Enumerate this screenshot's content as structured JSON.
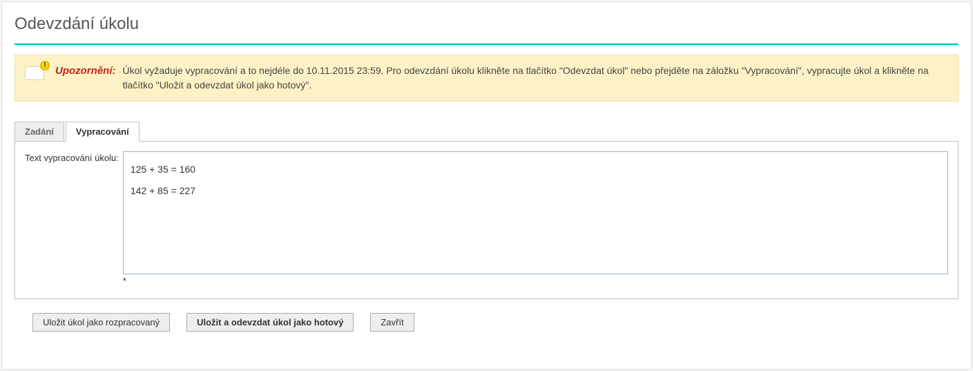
{
  "page": {
    "title": "Odevzdání úkolu"
  },
  "alert": {
    "label": "Upozornění:",
    "text": "Úkol vyžaduje vypracování a to nejdéle do 10.11.2015 23:59. Pro odevzdání úkolu klikněte na tlačítko \"Odevzdat úkol\" nebo přejděte na záložku \"Vypracování\", vypracujte úkol a klikněte na tlačítko \"Uložit a odevzdat úkol jako hotový\"."
  },
  "tabs": {
    "assignment": "Zadání",
    "elaboration": "Vypracování"
  },
  "form": {
    "label": "Text vypracování úkolu:",
    "value": "125 + 35 = 160\n142 + 85 = 227",
    "required_mark": "*"
  },
  "buttons": {
    "save_draft": "Uložit úkol jako rozpracovaný",
    "save_submit": "Uložit a odevzdat úkol jako hotový",
    "close": "Zavřít"
  }
}
